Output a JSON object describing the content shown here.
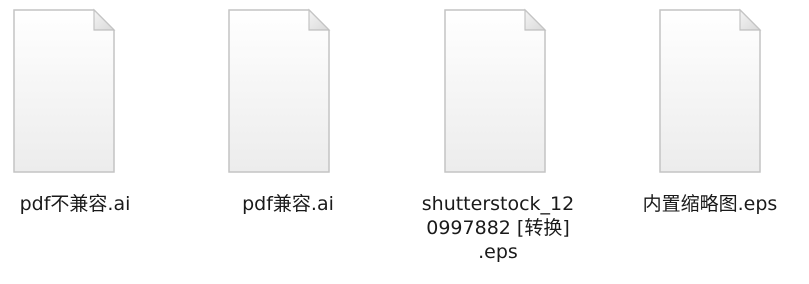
{
  "files": [
    {
      "label": "pdf不兼容.ai",
      "icon": "generic-document-icon"
    },
    {
      "label": "pdf兼容.ai",
      "icon": "generic-document-icon"
    },
    {
      "label_lines": [
        "shutterstock_12",
        "0997882 [转换]",
        ".eps"
      ],
      "icon": "generic-document-icon"
    },
    {
      "label": "内置缩略图.eps",
      "icon": "generic-document-icon"
    }
  ],
  "colors": {
    "page_fill_top": "#ffffff",
    "page_fill_bottom": "#eeeeee",
    "page_border": "#c8c8c8",
    "fold_fill": "#e6e6e6",
    "label_text": "#1a1a1a"
  }
}
